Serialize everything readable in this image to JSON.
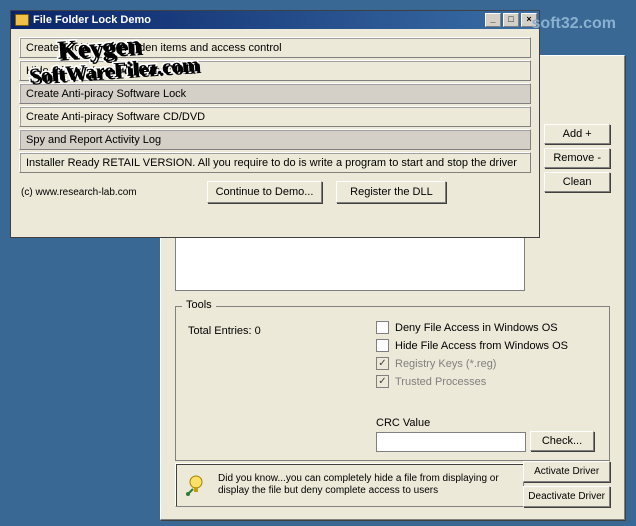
{
  "watermark": "soft32.com",
  "stamp": {
    "line1": "Keygen",
    "line2": "SoftWareFilez.com"
  },
  "back": {
    "side_buttons": {
      "add": "Add +",
      "remove": "Remove -",
      "clean": "Clean"
    },
    "tools": {
      "legend": "Tools",
      "total_entries": "Total Entries: 0",
      "checks": {
        "deny": "Deny File Access in Windows OS",
        "hide": "Hide File Access from Windows  OS",
        "reg": "Registry Keys (*.reg)",
        "trusted": "Trusted Processes"
      },
      "crc_label": "CRC Value",
      "check_btn": "Check..."
    },
    "tip": "Did you know...you can completely hide a file from displaying or display the file but deny complete access to users",
    "driver": {
      "activate": "Activate Driver",
      "deactivate": "Deactivate Driver"
    }
  },
  "front": {
    "title": "File Folder Lock Demo",
    "options": [
      {
        "label": "Create a folder with hidden items and access control"
      },
      {
        "label": "Hide a folder / unhide hidden folder"
      },
      {
        "label": "Create Anti-piracy Software Lock",
        "selected": true
      },
      {
        "label": "Create Anti-piracy Software CD/DVD"
      },
      {
        "label": "Spy and Report Activity Log",
        "selected": true
      },
      {
        "label": "Installer Ready RETAIL VERSION. All you require to do is write a program to start and stop the driver"
      }
    ],
    "credit": "(c) www.research-lab.com",
    "continue_btn": "Continue to Demo...",
    "register_btn": "Register the DLL"
  }
}
